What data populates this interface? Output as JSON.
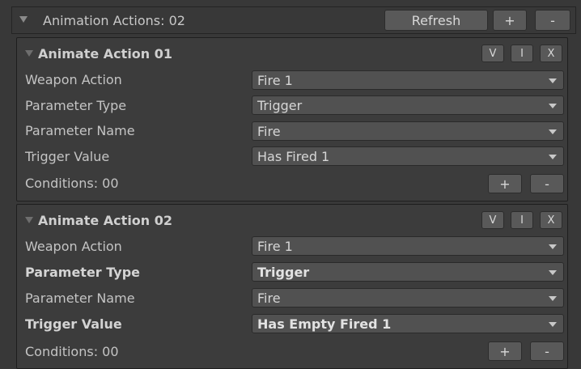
{
  "header": {
    "title": "Animation Actions: 02",
    "refresh_label": "Refresh",
    "add_label": "+",
    "remove_label": "-"
  },
  "actions": [
    {
      "title": "Animate Action 01",
      "v_label": "V",
      "i_label": "I",
      "x_label": "X",
      "rows": [
        {
          "label": "Weapon Action",
          "value": "Fire 1"
        },
        {
          "label": "Parameter Type",
          "value": "Trigger"
        },
        {
          "label": "Parameter Name",
          "value": "Fire"
        },
        {
          "label": "Trigger Value",
          "value": "Has Fired 1"
        }
      ],
      "conditions_label": "Conditions: 00",
      "add_label": "+",
      "remove_label": "-"
    },
    {
      "title": "Animate Action 02",
      "v_label": "V",
      "i_label": "I",
      "x_label": "X",
      "rows": [
        {
          "label": "Weapon Action",
          "value": "Fire 1"
        },
        {
          "label": "Parameter Type",
          "value": "Trigger"
        },
        {
          "label": "Parameter Name",
          "value": "Fire"
        },
        {
          "label": "Trigger Value",
          "value": "Has Empty Fired 1"
        }
      ],
      "conditions_label": "Conditions: 00",
      "add_label": "+",
      "remove_label": "-"
    }
  ]
}
